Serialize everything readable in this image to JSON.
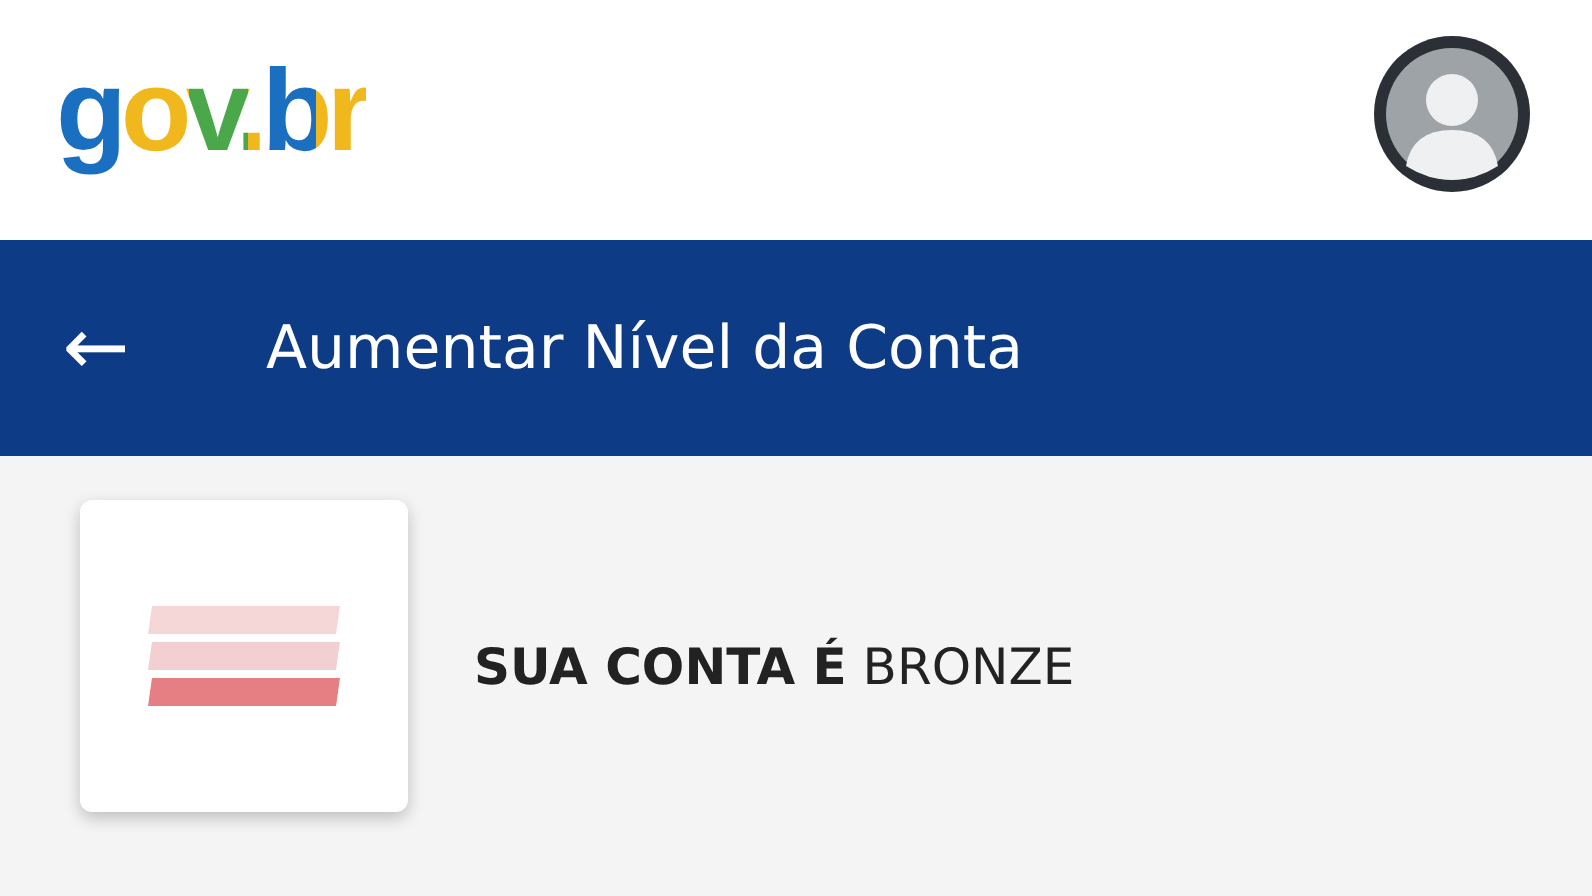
{
  "header": {
    "logo": "gov.br"
  },
  "title_bar": {
    "back": "←",
    "title": "Aumentar Nível da Conta"
  },
  "account": {
    "level_bars": [
      {
        "filled": false
      },
      {
        "filled": false
      },
      {
        "filled": true
      }
    ],
    "text": "**SUA CONTA É** BRONZE"
  }
}
